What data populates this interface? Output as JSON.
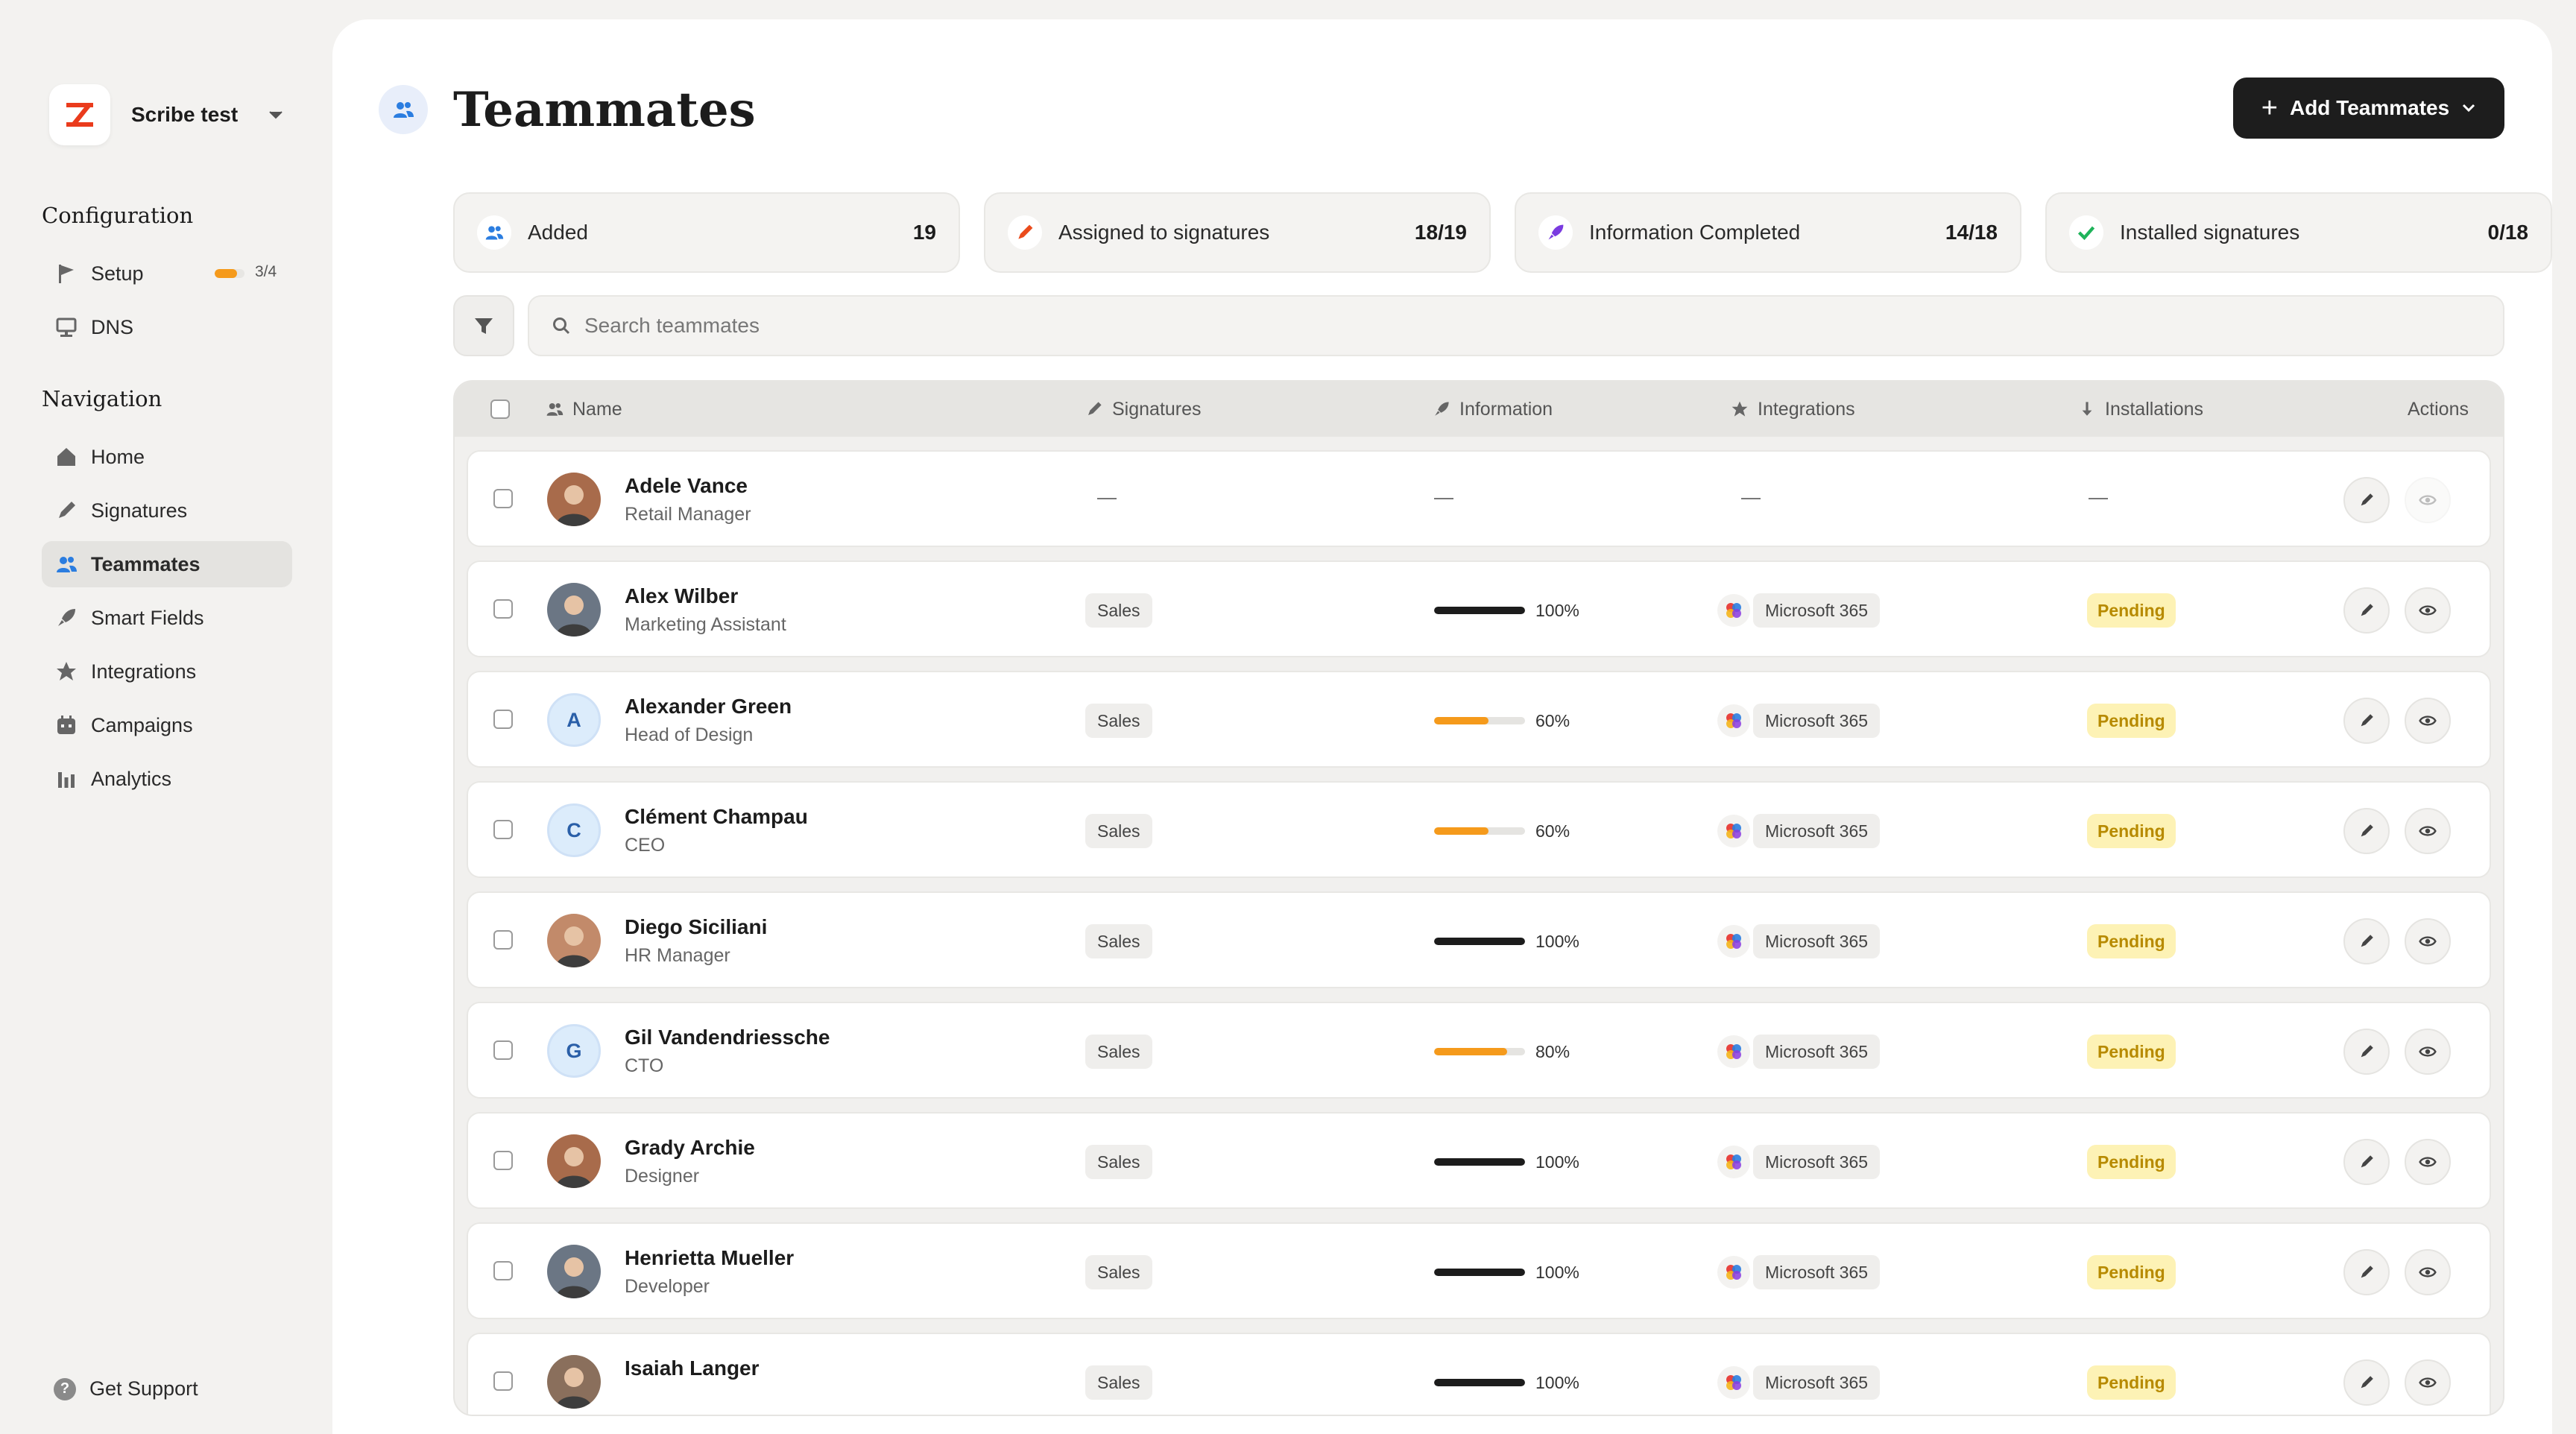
{
  "workspace": {
    "name": "Scribe test"
  },
  "sidebar": {
    "configuration_title": "Configuration",
    "configuration_items": [
      {
        "label": "Setup",
        "icon": "flag-icon",
        "progress_text": "3/4",
        "progress": 0.75
      },
      {
        "label": "DNS",
        "icon": "dns-icon"
      }
    ],
    "navigation_title": "Navigation",
    "navigation_items": [
      {
        "label": "Home",
        "icon": "home-icon"
      },
      {
        "label": "Signatures",
        "icon": "pen-icon"
      },
      {
        "label": "Teammates",
        "icon": "users-icon",
        "active": true
      },
      {
        "label": "Smart Fields",
        "icon": "rocket-icon"
      },
      {
        "label": "Integrations",
        "icon": "star-icon"
      },
      {
        "label": "Campaigns",
        "icon": "calendar-icon"
      },
      {
        "label": "Analytics",
        "icon": "bar-chart-icon"
      }
    ],
    "support_label": "Get Support"
  },
  "header": {
    "title": "Teammates",
    "add_button_label": "Add Teammates"
  },
  "stats": [
    {
      "label": "Added",
      "value": "19",
      "icon": "users-icon"
    },
    {
      "label": "Assigned to signatures",
      "value": "18/19",
      "icon": "pen-icon"
    },
    {
      "label": "Information Completed",
      "value": "14/18",
      "icon": "rocket-icon"
    },
    {
      "label": "Installed signatures",
      "value": "0/18",
      "icon": "check-icon"
    }
  ],
  "search": {
    "placeholder": "Search teammates"
  },
  "table": {
    "columns": {
      "name": "Name",
      "signatures": "Signatures",
      "information": "Information",
      "integrations": "Integrations",
      "installations": "Installations",
      "actions": "Actions"
    },
    "rows": [
      {
        "name": "Adele Vance",
        "role": "Retail Manager",
        "avatar": "photo",
        "signature": "",
        "info": "",
        "integration": "",
        "installation": ""
      },
      {
        "name": "Alex Wilber",
        "role": "Marketing Assistant",
        "avatar": "photo",
        "signature": "Sales",
        "info": "100%",
        "info_value": 1.0,
        "integration": "Microsoft 365",
        "installation": "Pending"
      },
      {
        "name": "Alexander Green",
        "role": "Head of Design",
        "avatar": "A",
        "signature": "Sales",
        "info": "60%",
        "info_value": 0.6,
        "integration": "Microsoft 365",
        "installation": "Pending"
      },
      {
        "name": "Clément Champau",
        "role": "CEO",
        "avatar": "C",
        "signature": "Sales",
        "info": "60%",
        "info_value": 0.6,
        "integration": "Microsoft 365",
        "installation": "Pending"
      },
      {
        "name": "Diego Siciliani",
        "role": "HR Manager",
        "avatar": "photo",
        "signature": "Sales",
        "info": "100%",
        "info_value": 1.0,
        "integration": "Microsoft 365",
        "installation": "Pending"
      },
      {
        "name": "Gil Vandendriessche",
        "role": "CTO",
        "avatar": "G",
        "signature": "Sales",
        "info": "80%",
        "info_value": 0.8,
        "integration": "Microsoft 365",
        "installation": "Pending"
      },
      {
        "name": "Grady Archie",
        "role": "Designer",
        "avatar": "photo",
        "signature": "Sales",
        "info": "100%",
        "info_value": 1.0,
        "integration": "Microsoft 365",
        "installation": "Pending"
      },
      {
        "name": "Henrietta Mueller",
        "role": "Developer",
        "avatar": "photo",
        "signature": "Sales",
        "info": "100%",
        "info_value": 1.0,
        "integration": "Microsoft 365",
        "installation": "Pending"
      },
      {
        "name": "Isaiah Langer",
        "role": "",
        "avatar": "photo",
        "signature": "Sales",
        "info": "100%",
        "info_value": 1.0,
        "integration": "Microsoft 365",
        "installation": "Pending"
      }
    ]
  },
  "colors": {
    "accent_orange": "#f59a1b",
    "progress_complete": "#1c1c1c",
    "pending_bg": "#fdf2b5",
    "pending_text": "#b78a00",
    "active_nav": "#e4e3e0"
  }
}
